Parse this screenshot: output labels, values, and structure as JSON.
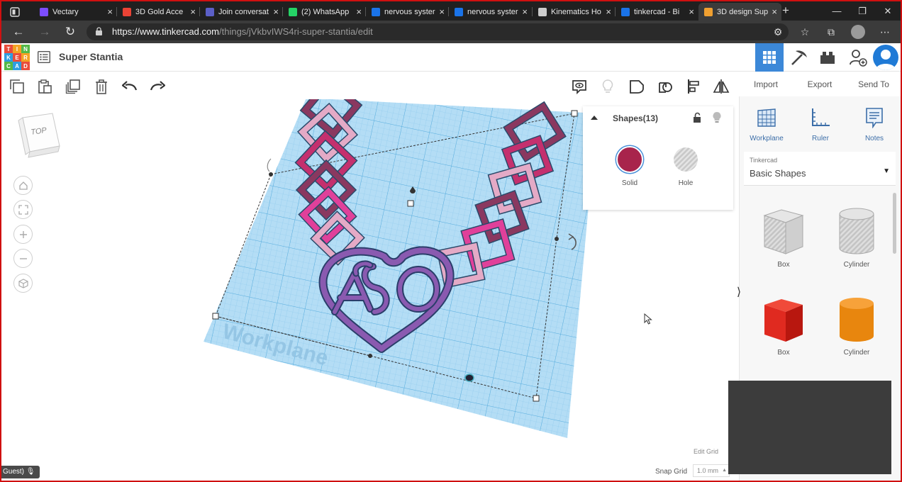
{
  "browser": {
    "tabs": [
      {
        "title": "Vectary",
        "favicon": "vectary-icon",
        "color": "#7c4dff"
      },
      {
        "title": "3D Gold Acce",
        "favicon": "gmail-icon",
        "color": "#ea4335"
      },
      {
        "title": "Join conversat",
        "favicon": "teams-icon",
        "color": "#5b5fc7"
      },
      {
        "title": "(2) WhatsApp",
        "favicon": "whatsapp-icon",
        "color": "#25d366"
      },
      {
        "title": "nervous syster",
        "favicon": "bing-icon",
        "color": "#1a73e8"
      },
      {
        "title": "nervous syster",
        "favicon": "bing-icon",
        "color": "#1a73e8"
      },
      {
        "title": "Kinematics Ho",
        "favicon": "document-icon",
        "color": "#cccccc"
      },
      {
        "title": "tinkercad - Bi",
        "favicon": "bing-icon",
        "color": "#1a73e8"
      },
      {
        "title": "3D design Sup",
        "favicon": "tinkercad-icon",
        "color": "#f0a030"
      }
    ],
    "active_tab_index": 8,
    "url_host": "https://www.tinkercad.com",
    "url_path": "/things/jVkbvIWS4ri-super-stantia/edit"
  },
  "app": {
    "logo_letters": [
      "TIN",
      "KER",
      "CAD"
    ],
    "logo_colors": [
      "#e94e3c",
      "#f4a224",
      "#54b848",
      "#2d9ee0"
    ],
    "project_name": "Super Stantia",
    "accent": "#3c88d8"
  },
  "right_menu": {
    "import": "Import",
    "export": "Export",
    "send_to": "Send To"
  },
  "shapes_panel": {
    "title": "Shapes(13)",
    "solid_label": "Solid",
    "solid_color": "#a8244c",
    "hole_label": "Hole"
  },
  "sidebar": {
    "tools": [
      {
        "label": "Workplane",
        "icon": "workplane-icon"
      },
      {
        "label": "Ruler",
        "icon": "ruler-icon"
      },
      {
        "label": "Notes",
        "icon": "notes-icon"
      }
    ],
    "library_category": "Tinkercad",
    "library_name": "Basic Shapes",
    "parts": [
      {
        "label": "Box",
        "style": "hatched"
      },
      {
        "label": "Cylinder",
        "style": "hatched"
      },
      {
        "label": "Box",
        "style": "red"
      },
      {
        "label": "Cylinder",
        "style": "orange"
      }
    ]
  },
  "canvas": {
    "view_cube_label": "TOP",
    "workplane_label": "Workplane",
    "edit_grid": "Edit Grid",
    "snap_grid_label": "Snap Grid",
    "snap_grid_value": "1.0 mm"
  },
  "overlay": {
    "guest_label": "Guest)"
  }
}
